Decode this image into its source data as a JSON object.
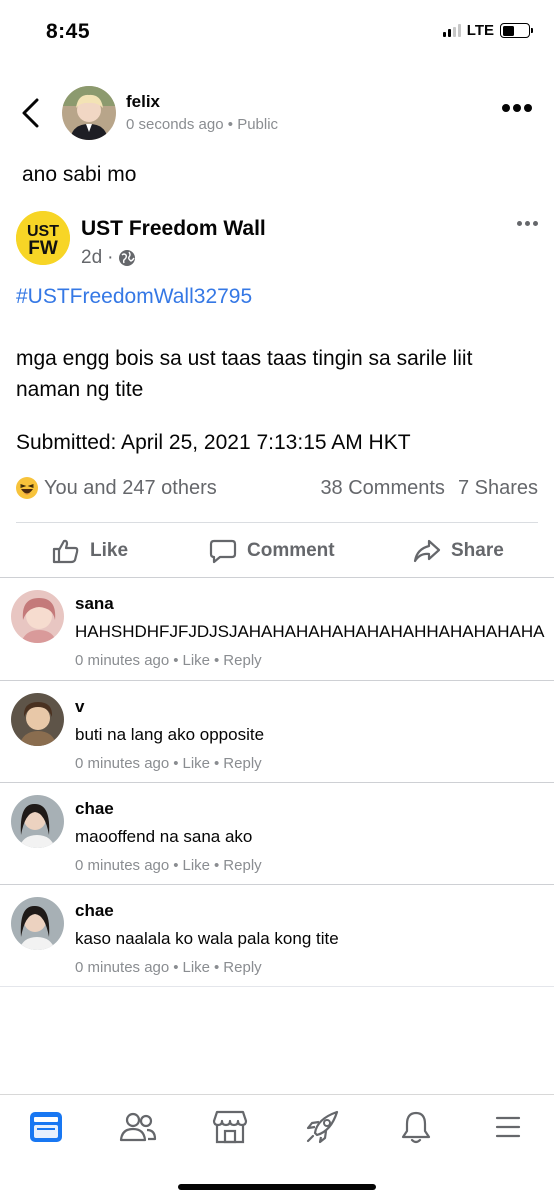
{
  "status_bar": {
    "time": "8:45",
    "network": "LTE"
  },
  "post": {
    "author_name": "felix",
    "timestamp": "0 seconds ago",
    "separator": "•",
    "privacy": "Public",
    "text": "ano sabi mo"
  },
  "shared_post": {
    "logo_text_top": "UST",
    "logo_text_bottom": "FW",
    "page_name": "UST Freedom Wall",
    "time": "2d",
    "separator": "·",
    "hashtag": "#USTFreedomWall32795",
    "body": "mga engg bois sa ust taas taas tingin sa sarile liit naman ng tite",
    "submitted": "Submitted:  April 25, 2021 7:13:15 AM HKT"
  },
  "reactions": {
    "summary": "You and 247 others",
    "comments": "38 Comments",
    "shares": "7 Shares"
  },
  "actions": {
    "like": "Like",
    "comment": "Comment",
    "share": "Share"
  },
  "comments": [
    {
      "name": "sana",
      "text": "HAHSHDHFJFJDJSJAHAHAHAHAHAHAHAHHAHAHAHAHA",
      "time": "0 minutes ago",
      "like": "Like",
      "reply": "Reply",
      "sep": "•"
    },
    {
      "name": "v",
      "text": "buti na lang ako opposite",
      "time": "0 minutes ago",
      "like": "Like",
      "reply": "Reply",
      "sep": "•"
    },
    {
      "name": "chae",
      "text": "maooffend na sana ako",
      "time": "0 minutes ago",
      "like": "Like",
      "reply": "Reply",
      "sep": "•"
    },
    {
      "name": "chae",
      "text": "kaso naalala ko wala pala kong tite",
      "time": "0 minutes ago",
      "like": "Like",
      "reply": "Reply",
      "sep": "•"
    }
  ],
  "colors": {
    "accent_blue": "#1877f2",
    "hashtag_blue": "#3578e5",
    "secondary_text": "#65676b",
    "logo_yellow": "#f7d526"
  },
  "bottom_nav": {
    "items": [
      "news-feed-icon",
      "friends-icon",
      "marketplace-icon",
      "gaming-icon",
      "notifications-icon",
      "menu-icon"
    ]
  }
}
